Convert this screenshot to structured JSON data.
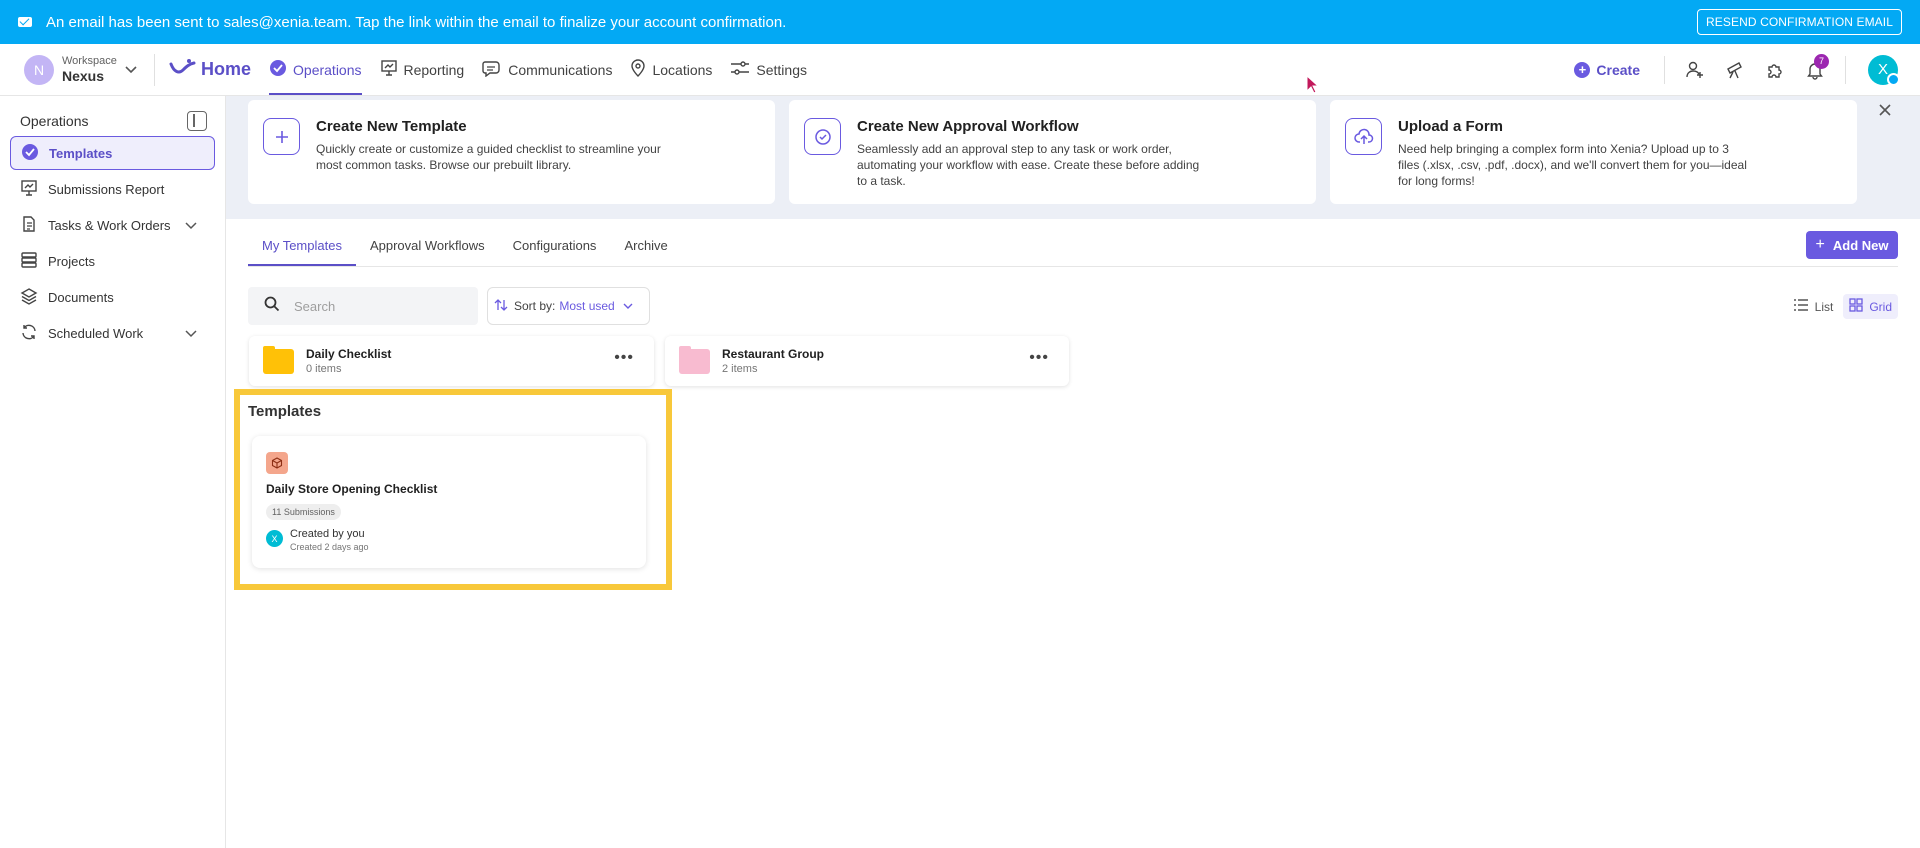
{
  "banner": {
    "message": "An email has been sent to sales@xenia.team. Tap the link within the email to finalize your account confirmation.",
    "resend_label": "RESEND CONFIRMATION EMAIL"
  },
  "nav": {
    "workspace_label": "Workspace",
    "workspace_name": "Nexus",
    "workspace_initial": "N",
    "home_label": "Home",
    "items": [
      {
        "label": "Operations",
        "icon": "check-circle-icon",
        "active": true
      },
      {
        "label": "Reporting",
        "icon": "presentation-chart-icon"
      },
      {
        "label": "Communications",
        "icon": "chat-bubble-icon"
      },
      {
        "label": "Locations",
        "icon": "map-pin-icon"
      },
      {
        "label": "Settings",
        "icon": "sliders-icon"
      }
    ],
    "create_label": "Create",
    "notification_count": "7",
    "user_initial": "X"
  },
  "sidebar": {
    "title": "Operations",
    "items": [
      {
        "label": "Templates",
        "icon": "check-circle-icon",
        "active": true
      },
      {
        "label": "Submissions Report",
        "icon": "presentation-chart-icon"
      },
      {
        "label": "Tasks & Work Orders",
        "icon": "document-icon",
        "expandable": true
      },
      {
        "label": "Projects",
        "icon": "stack-icon"
      },
      {
        "label": "Documents",
        "icon": "layers-icon"
      },
      {
        "label": "Scheduled Work",
        "icon": "recurring-icon",
        "expandable": true
      }
    ]
  },
  "promo_cards": [
    {
      "title": "Create New Template",
      "description": "Quickly create or customize a guided checklist to streamline your most common tasks. Browse our prebuilt library.",
      "icon": "plus-icon"
    },
    {
      "title": "Create New Approval Workflow",
      "description": "Seamlessly add an approval step to any task or work order, automating your workflow with ease. Create these before adding to a task.",
      "icon": "check-badge-icon"
    },
    {
      "title": "Upload a Form",
      "description": "Need help bringing a complex form into Xenia? Upload up to 3 files (.xlsx, .csv, .pdf, .docx), and we'll convert them for you—ideal for long forms!",
      "icon": "cloud-upload-icon"
    }
  ],
  "tabs": [
    "My Templates",
    "Approval Workflows",
    "Configurations",
    "Archive"
  ],
  "add_new_label": "Add New",
  "search": {
    "placeholder": "Search"
  },
  "sort": {
    "label": "Sort by:",
    "value": "Most used"
  },
  "view": {
    "list_label": "List",
    "grid_label": "Grid",
    "active": "Grid"
  },
  "folders": [
    {
      "name": "Daily Checklist",
      "count": "0 items",
      "color": "#ffc107"
    },
    {
      "name": "Restaurant Group",
      "count": "2 items",
      "color": "#f8bbd0"
    }
  ],
  "templates_heading": "Templates",
  "templates": [
    {
      "name": "Daily Store Opening Checklist",
      "submissions": "11 Submissions",
      "created_by": "Created by you",
      "created_at": "Created 2 days ago",
      "avatar_initial": "X",
      "icon_color": "#f4a68c"
    }
  ],
  "colors": {
    "accent": "#6a5ae0",
    "banner": "#03a9f4",
    "highlight": "#f8c83a"
  }
}
